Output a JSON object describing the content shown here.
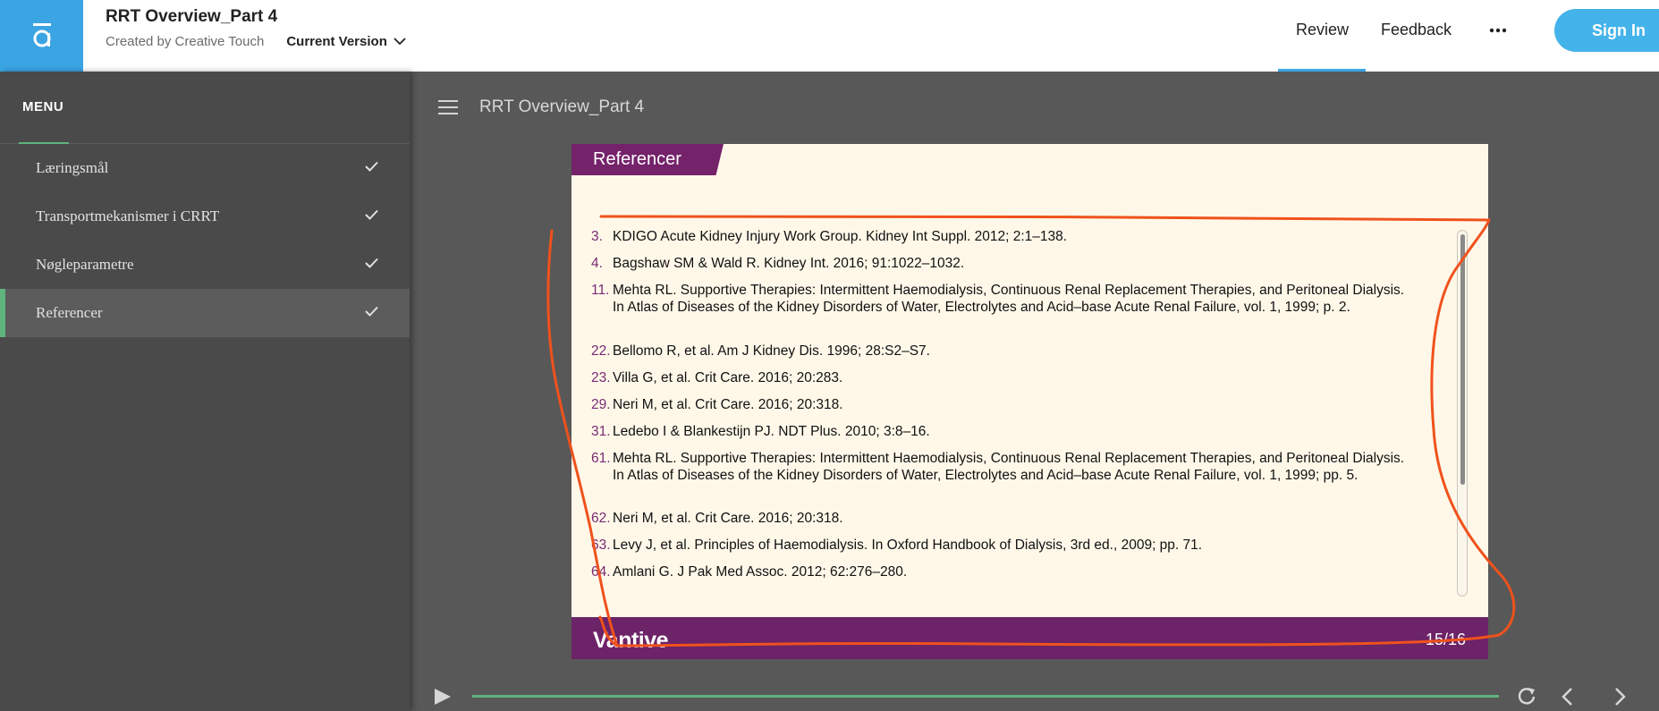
{
  "header": {
    "course_title": "RRT Overview_Part 4",
    "creator": "Created by Creative Touch",
    "version_label": "Current Version",
    "nav": [
      "Review",
      "Feedback"
    ],
    "more_icon": "more-dots-icon",
    "signin_label": "Sign In",
    "brand_color": "#3ba5e3"
  },
  "sidebar": {
    "menu_label": "MENU",
    "items": [
      {
        "label": "Læringsmål",
        "completed": true
      },
      {
        "label": "Transportmekanismer i CRRT",
        "completed": true
      },
      {
        "label": "Nøgleparametre",
        "completed": true
      },
      {
        "label": "Referencer",
        "completed": true,
        "active": true
      }
    ],
    "accent_color": "#5fb37d"
  },
  "main": {
    "lesson_title": "RRT Overview_Part 4"
  },
  "slide": {
    "section_title": "Referencer",
    "references": [
      {
        "num": "3.",
        "text": "KDIGO Acute Kidney Injury Work Group. Kidney Int Suppl. 2012; 2:1–138."
      },
      {
        "num": "4.",
        "text": "Bagshaw SM & Wald R. Kidney Int. 2016; 91:1022–1032."
      },
      {
        "num": "11.",
        "text": "Mehta RL. Supportive Therapies: Intermittent Haemodialysis, Continuous Renal Replacement Therapies, and Peritoneal Dialysis. In Atlas of Diseases of the Kidney Disorders of Water, Electrolytes and Acid–base Acute Renal Failure, vol. 1, 1999; p. 2."
      },
      {
        "num": "22.",
        "text": "Bellomo R, et al. Am J Kidney Dis. 1996; 28:S2–S7."
      },
      {
        "num": "23.",
        "text": "Villa G, et al. Crit Care. 2016; 20:283."
      },
      {
        "num": "29.",
        "text": "Neri M, et al. Crit Care. 2016; 20:318."
      },
      {
        "num": "31.",
        "text": "Ledebo I & Blankestijn PJ. NDT Plus. 2010; 3:8–16."
      },
      {
        "num": "61.",
        "text": "Mehta RL. Supportive Therapies: Intermittent Haemodialysis, Continuous Renal Replacement Therapies, and Peritoneal Dialysis. In Atlas of Diseases of the Kidney Disorders of Water, Electrolytes and Acid–base Acute Renal Failure, vol. 1, 1999; pp. 5."
      },
      {
        "num": "62.",
        "text": "Neri M, et al. Crit Care. 2016; 20:318."
      },
      {
        "num": "63.",
        "text": "Levy J, et al. Principles of Haemodialysis. In Oxford Handbook of Dialysis, 3rd ed., 2009; pp. 71."
      },
      {
        "num": "64.",
        "text": "Amlani G. J Pak Med Assoc. 2012; 62:276–280."
      }
    ],
    "brand": "Vantive",
    "page_indicator": "15/16",
    "accent_color": "#74226a",
    "background_color": "#fff8e9"
  },
  "player": {
    "icons": [
      "play-icon",
      "replay-icon",
      "previous-icon",
      "next-icon"
    ]
  }
}
